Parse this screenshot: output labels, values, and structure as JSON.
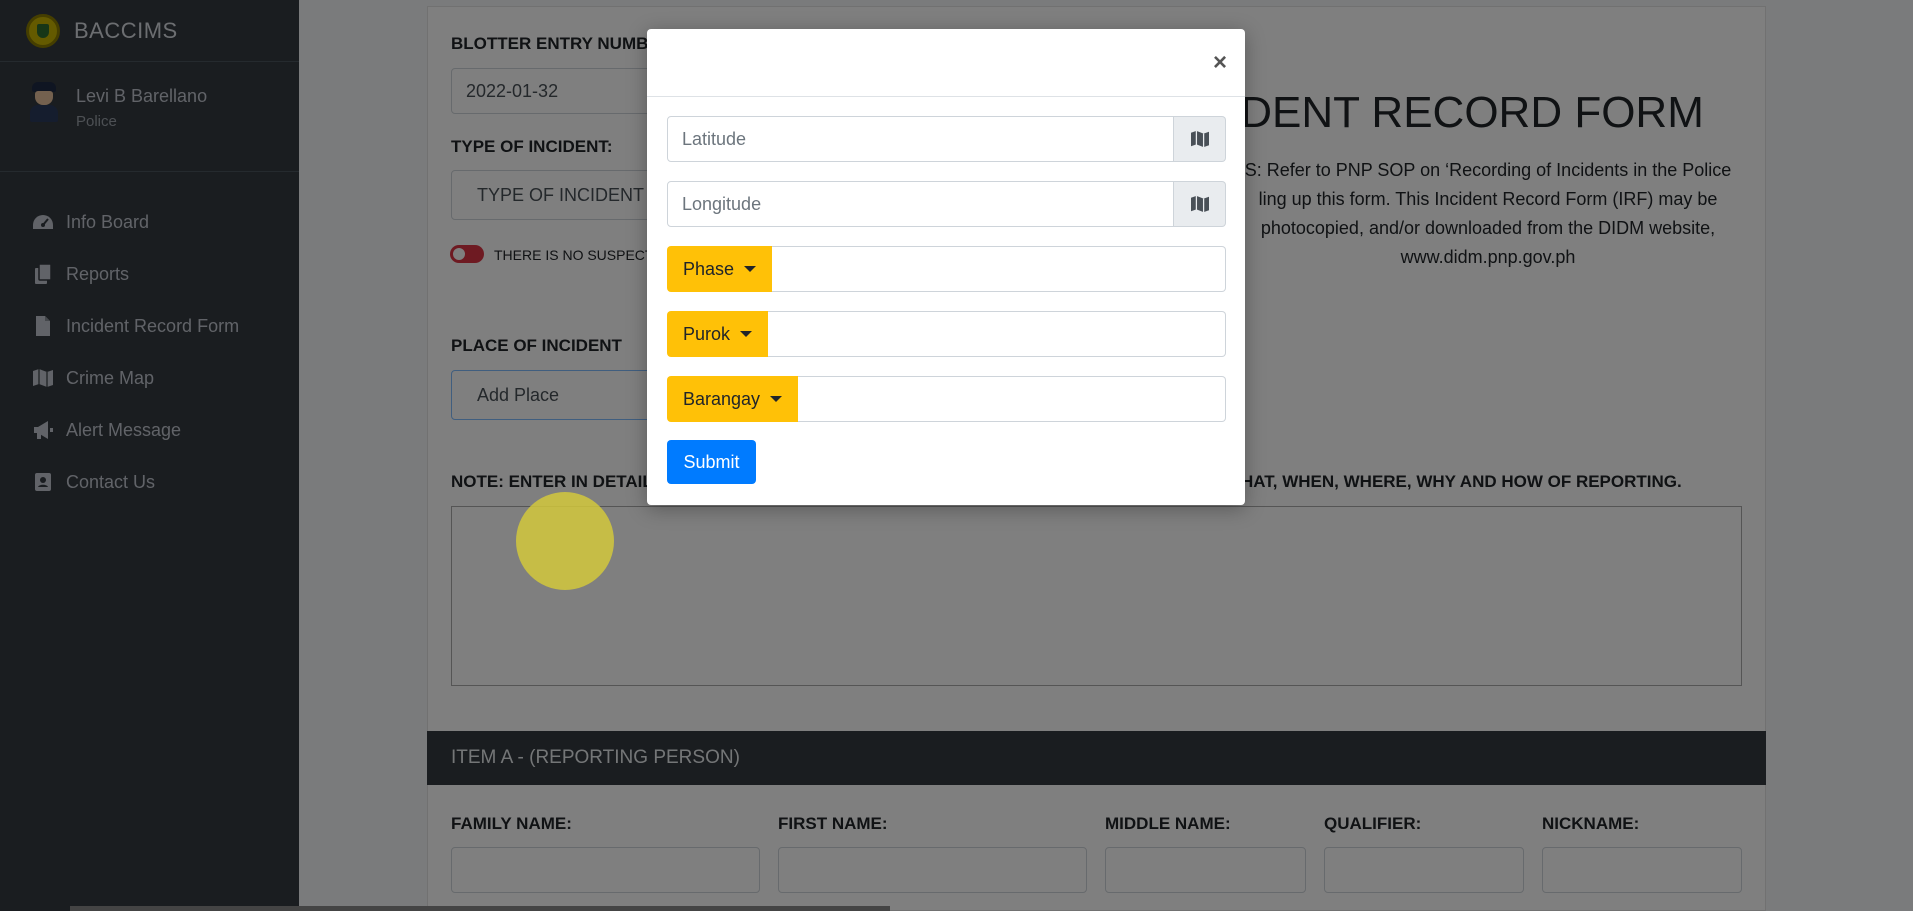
{
  "sidebar": {
    "brand": "BACCIMS",
    "user": {
      "name": "Levi B Barellano",
      "role": "Police"
    },
    "items": [
      {
        "label": "Info Board",
        "icon": "dashboard-icon"
      },
      {
        "label": "Reports",
        "icon": "copy-icon"
      },
      {
        "label": "Incident Record Form",
        "icon": "file-icon"
      },
      {
        "label": "Crime Map",
        "icon": "map-icon"
      },
      {
        "label": "Alert Message",
        "icon": "bullhorn-icon"
      },
      {
        "label": "Contact Us",
        "icon": "contact-card-icon"
      }
    ]
  },
  "form": {
    "blotter_label": "BLOTTER ENTRY NUMB",
    "blotter_value": "2022-01-32",
    "type_label": "TYPE OF INCIDENT:",
    "type_value": "TYPE OF INCIDENT",
    "no_suspect_label": "THERE IS NO SUSPECT I",
    "place_label": "PLACE OF INCIDENT",
    "place_value": "Add Place",
    "note_left": "NOTE: ENTER IN DETAIL",
    "note_right": "HAT, WHEN, WHERE, WHY AND HOW OF REPORTING.",
    "irf_title": "IDENT RECORD FORM",
    "irf_desc_lines": [
      "S: Refer to PNP SOP on ‘Recording of Incidents in the Police",
      "ling up this form. This Incident Record Form (IRF) may be",
      "photocopied, and/or downloaded from the DIDM website,",
      "www.didm.pnp.gov.ph"
    ],
    "item_a_header": "ITEM A - (REPORTING PERSON)",
    "name_labels": {
      "family": "FAMILY NAME:",
      "first": "FIRST NAME:",
      "middle": "MIDDLE NAME:",
      "qualifier": "QUALIFIER:",
      "nickname": "NICKNAME:"
    }
  },
  "modal": {
    "close": "×",
    "latitude_placeholder": "Latitude",
    "longitude_placeholder": "Longitude",
    "phase_label": "Phase",
    "purok_label": "Purok",
    "barangay_label": "Barangay",
    "submit_label": "Submit"
  },
  "colors": {
    "sidebar": "#343a40",
    "warning": "#ffc107",
    "primary": "#007bff",
    "danger": "#dc3545"
  }
}
